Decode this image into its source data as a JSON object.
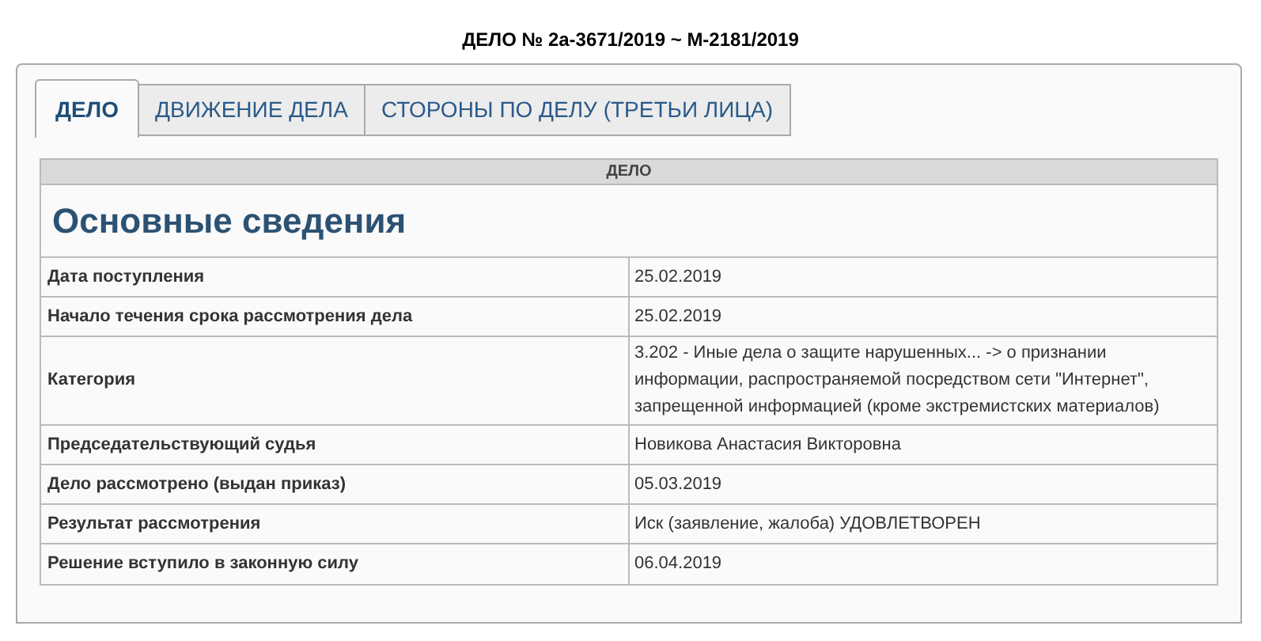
{
  "title": "ДЕЛО № 2а-3671/2019 ~ М-2181/2019",
  "tabs": [
    {
      "label": "ДЕЛО",
      "selected": true
    },
    {
      "label": "ДВИЖЕНИЕ ДЕЛА",
      "selected": false
    },
    {
      "label": "СТОРОНЫ ПО ДЕЛУ (ТРЕТЬИ ЛИЦА)",
      "selected": false
    }
  ],
  "table": {
    "caption": "ДЕЛО",
    "heading": "Основные сведения",
    "rows": [
      {
        "label": "Дата поступления",
        "value": "25.02.2019"
      },
      {
        "label": "Начало течения срока рассмотрения дела",
        "value": "25.02.2019"
      },
      {
        "label": "Категория",
        "value": "3.202 - Иные дела о защите нарушенных... -> о признании информации, распространяемой посредством сети \"Интернет\", запрещенной информацией (кроме экстремистских материалов)"
      },
      {
        "label": "Председательствующий судья",
        "value": "Новикова Анастасия Викторовна"
      },
      {
        "label": "Дело рассмотрено (выдан приказ)",
        "value": "05.03.2019"
      },
      {
        "label": "Результат рассмотрения",
        "value": "Иск (заявление, жалоба) УДОВЛЕТВОРЕН"
      },
      {
        "label": "Решение вступило в законную силу",
        "value": "06.04.2019"
      }
    ]
  }
}
